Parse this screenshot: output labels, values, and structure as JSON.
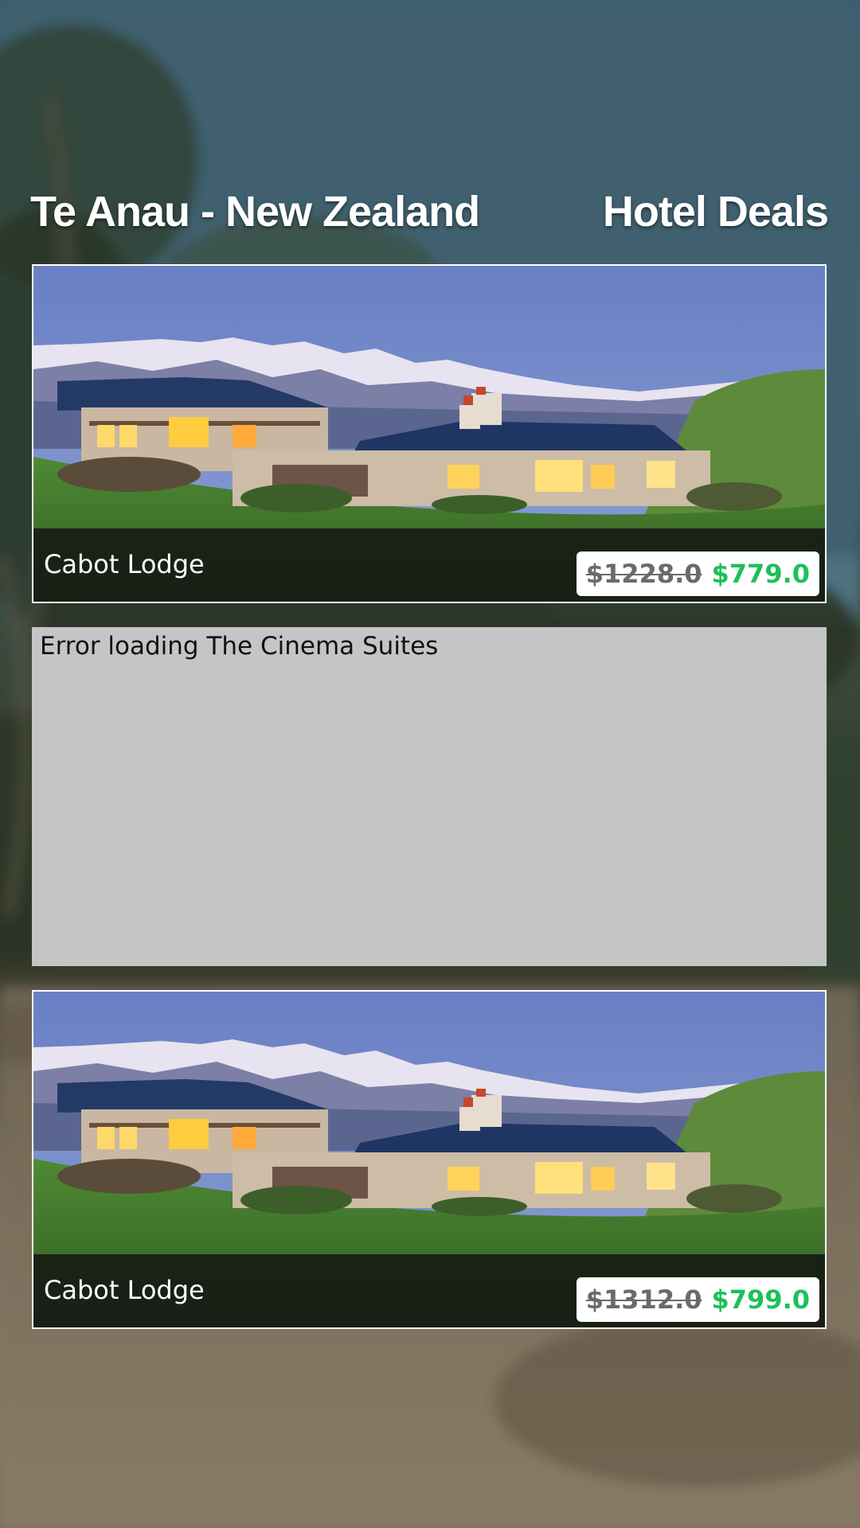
{
  "header": {
    "location_title": "Te Anau - New Zealand",
    "section_title": "Hotel Deals"
  },
  "deals": [
    {
      "name": "Cabot Lodge",
      "original_price": "$1228.0",
      "deal_price": "$779.0",
      "image_icon": "hotel-photo"
    },
    {
      "error_message": "Error loading The Cinema Suites"
    },
    {
      "name": "Cabot Lodge",
      "original_price": "$1312.0",
      "deal_price": "$799.0",
      "image_icon": "hotel-photo"
    }
  ],
  "colors": {
    "deal_price": "#1fbf5a",
    "original_price": "#6a6a6a",
    "error_background": "#c5c5c5",
    "card_border": "#ffffff"
  }
}
